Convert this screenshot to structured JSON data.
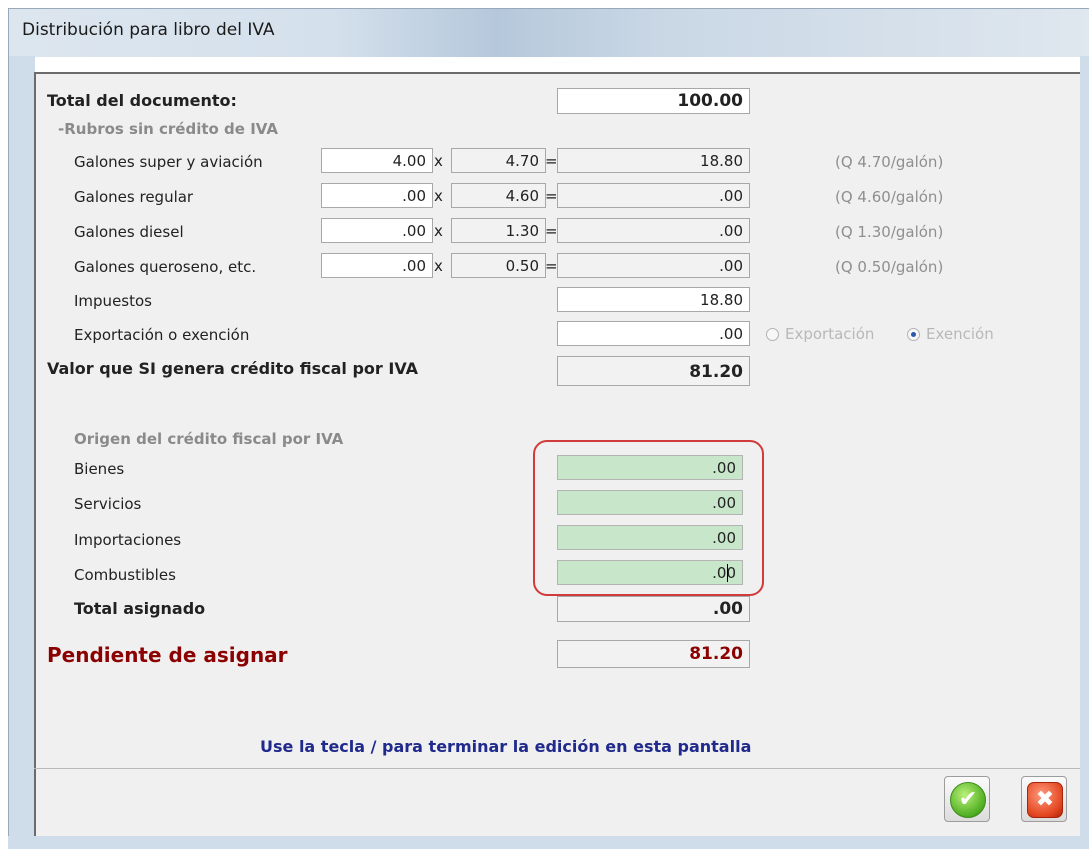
{
  "window": {
    "title": "Distribución para libro del IVA"
  },
  "total": {
    "label": "Total del documento:",
    "value": "100.00"
  },
  "rubros": {
    "header": "-Rubros sin crédito de IVA",
    "rows": [
      {
        "label": "Galones super y aviación",
        "qty": "4.00",
        "rate": "4.70",
        "result": "18.80",
        "hint": "(Q 4.70/galón)"
      },
      {
        "label": "Galones regular",
        "qty": ".00",
        "rate": "4.60",
        "result": ".00",
        "hint": "(Q 4.60/galón)"
      },
      {
        "label": "Galones diesel",
        "qty": ".00",
        "rate": "1.30",
        "result": ".00",
        "hint": "(Q 1.30/galón)"
      },
      {
        "label": "Galones queroseno, etc.",
        "qty": ".00",
        "rate": "0.50",
        "result": ".00",
        "hint": "(Q 0.50/galón)"
      }
    ],
    "times": "x",
    "equals": "=",
    "impuestos": {
      "label": "Impuestos",
      "value": "18.80"
    },
    "exportacion": {
      "label": "Exportación o exención",
      "value": ".00",
      "options": [
        "Exportación",
        "Exención"
      ],
      "selected": "Exención"
    }
  },
  "valor_credito": {
    "label": "Valor que SI genera crédito fiscal por IVA",
    "value": "81.20"
  },
  "origen": {
    "header": "Origen del crédito fiscal por IVA",
    "rows": [
      {
        "label": "Bienes",
        "value": ".00"
      },
      {
        "label": "Servicios",
        "value": ".00"
      },
      {
        "label": "Importaciones",
        "value": ".00"
      },
      {
        "label": "Combustibles",
        "value": ".00"
      }
    ],
    "highlight_color": "#d23b3b",
    "field_color": "#c8e6c9"
  },
  "total_asignado": {
    "label": "Total asignado",
    "value": ".00"
  },
  "pendiente": {
    "label": "Pendiente de asignar",
    "value": "81.20",
    "color": "#8b0000"
  },
  "footer": {
    "message": "Use la tecla / para terminar la edición en esta pantalla"
  },
  "buttons": {
    "ok_icon": "check-icon",
    "cancel_icon": "close-icon"
  }
}
